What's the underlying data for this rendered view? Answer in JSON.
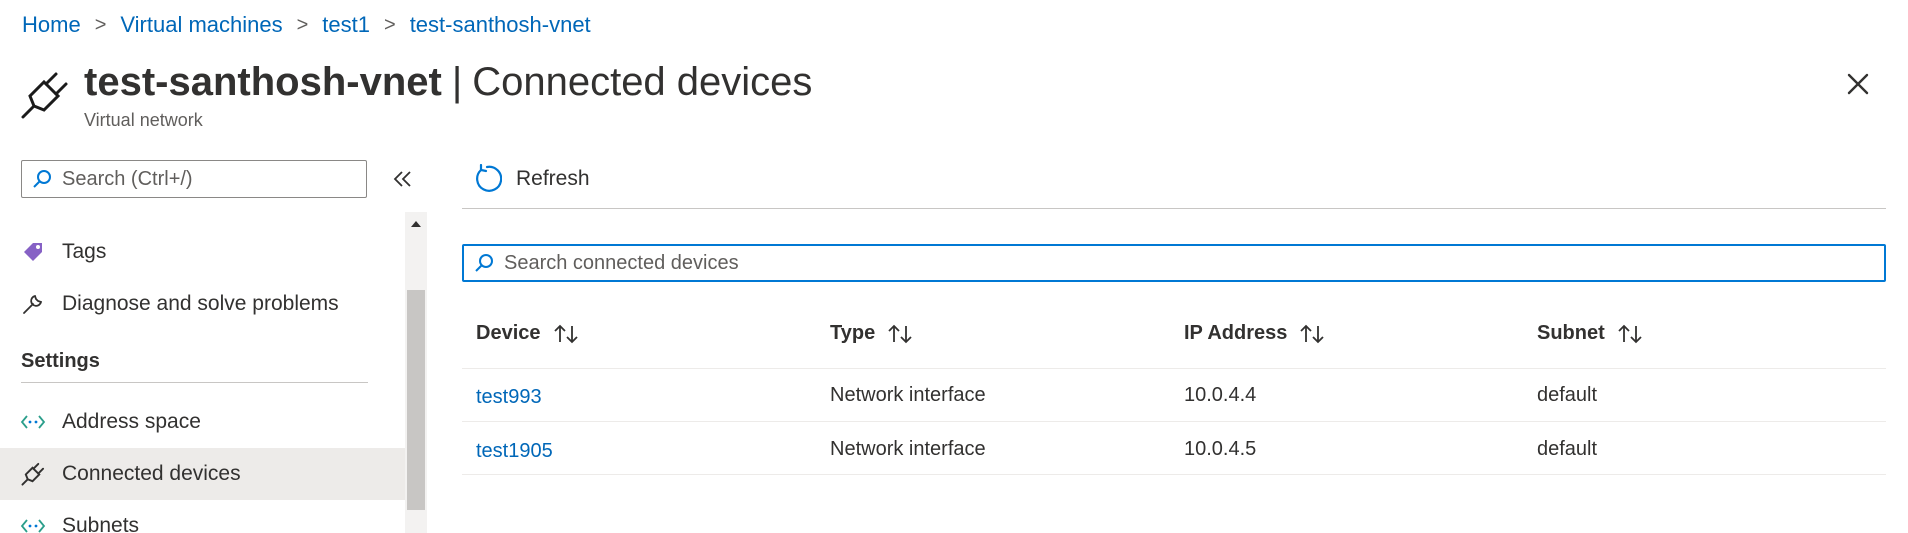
{
  "breadcrumb": [
    "Home",
    "Virtual machines",
    "test1",
    "test-santhosh-vnet"
  ],
  "header": {
    "resource_name": "test-santhosh-vnet",
    "separator": "|",
    "blade_name": "Connected devices",
    "subtitle": "Virtual network"
  },
  "sidebar": {
    "search_placeholder": "Search (Ctrl+/)",
    "items_top": [
      {
        "label": "Tags",
        "icon": "tag-icon"
      },
      {
        "label": "Diagnose and solve problems",
        "icon": "wrench-icon"
      }
    ],
    "section_title": "Settings",
    "items_settings": [
      {
        "label": "Address space",
        "icon": "code-brackets-icon"
      },
      {
        "label": "Connected devices",
        "icon": "plug-icon",
        "selected": true
      },
      {
        "label": "Subnets",
        "icon": "code-brackets-icon"
      }
    ]
  },
  "toolbar": {
    "refresh_label": "Refresh"
  },
  "search": {
    "placeholder": "Search connected devices"
  },
  "table": {
    "columns": [
      "Device",
      "Type",
      "IP Address",
      "Subnet"
    ],
    "rows": [
      {
        "device": "test993",
        "type": "Network interface",
        "ip": "10.0.4.4",
        "subnet": "default"
      },
      {
        "device": "test1905",
        "type": "Network interface",
        "ip": "10.0.4.5",
        "subnet": "default"
      }
    ]
  },
  "colors": {
    "link": "#0067b8",
    "accent": "#0078d4",
    "selected_bg": "#edebe9",
    "tag": "#8661c5"
  }
}
